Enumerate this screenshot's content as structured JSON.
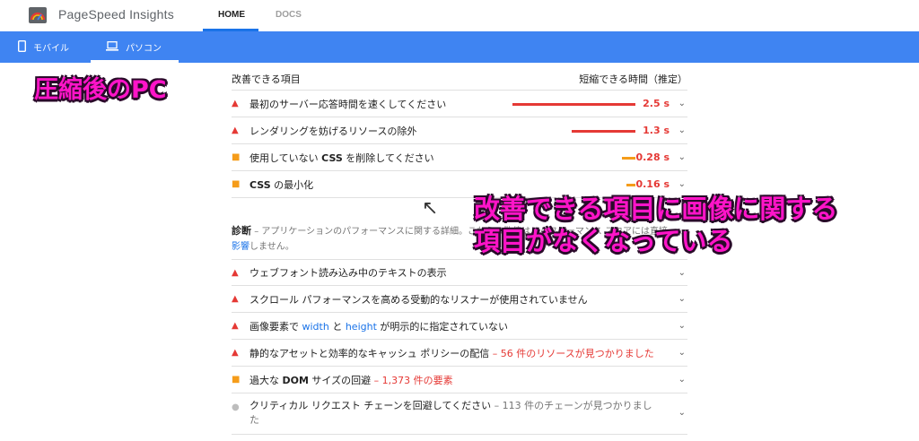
{
  "header": {
    "app_title": "PageSpeed Insights",
    "nav": [
      {
        "label": "HOME",
        "active": true
      },
      {
        "label": "DOCS",
        "active": false
      }
    ]
  },
  "device_bar": {
    "tabs": [
      {
        "label": "モバイル",
        "icon": "phone-icon",
        "active": false
      },
      {
        "label": "パソコン",
        "icon": "laptop-icon",
        "active": true
      }
    ]
  },
  "annotations": {
    "title": "圧縮後のPC",
    "arrow": "↖",
    "note_line1": "改善できる項目に画像に関する",
    "note_line2": "項目がなくなっている"
  },
  "opportunities": {
    "heading": "改善できる項目",
    "heading_right": "短縮できる時間（推定）",
    "items": [
      {
        "label": "最初のサーバー応答時間を速くしてください",
        "value": "2.5 s",
        "savings_seconds": 2.5,
        "severity": "fail"
      },
      {
        "label": "レンダリングを妨げるリソースの除外",
        "value": "1.3 s",
        "savings_seconds": 1.3,
        "severity": "fail"
      },
      {
        "label_pre": "使用していない ",
        "label_bold": "CSS",
        "label_post": " を削除してください",
        "value": "0.28 s",
        "savings_seconds": 0.28,
        "severity": "average"
      },
      {
        "label_bold": "CSS",
        "label_post": " の最小化",
        "value": "0.16 s",
        "savings_seconds": 0.16,
        "severity": "average"
      }
    ]
  },
  "diagnostics": {
    "heading": "診断",
    "description": "– アプリケーションのパフォーマンスに関する詳細。これらの数値は、パフォーマンス スコアには直接",
    "description_link": "影響",
    "description_end": "しません。",
    "items": [
      {
        "label": "ウェブフォント読み込み中のテキストの表示",
        "severity": "fail"
      },
      {
        "label": "スクロール パフォーマンスを高める受動的なリスナーが使用されていません",
        "severity": "fail"
      },
      {
        "pre": "画像要素で ",
        "code1": "width",
        "mid": " と ",
        "code2": "height",
        "post": " が明示的に指定されていない",
        "severity": "fail"
      },
      {
        "label": "静的なアセットと効率的なキャッシュ ポリシーの配信",
        "detail": "– 56 件のリソースが見つかりました",
        "severity": "fail"
      },
      {
        "pre": "過大な ",
        "bold": "DOM",
        "post": " サイズの回避",
        "detail": "– 1,373 件の要素",
        "severity": "average"
      },
      {
        "label": "クリティカル リクエスト チェーンを回避してください",
        "detail_l1": "– 113 件のチェーンが見つかりまし",
        "detail_l2": "た",
        "severity": "info"
      }
    ]
  },
  "colors": {
    "fail": "#e53935",
    "average": "#f59c1a",
    "info": "#bdbdbd",
    "accent": "#3f84f2"
  }
}
